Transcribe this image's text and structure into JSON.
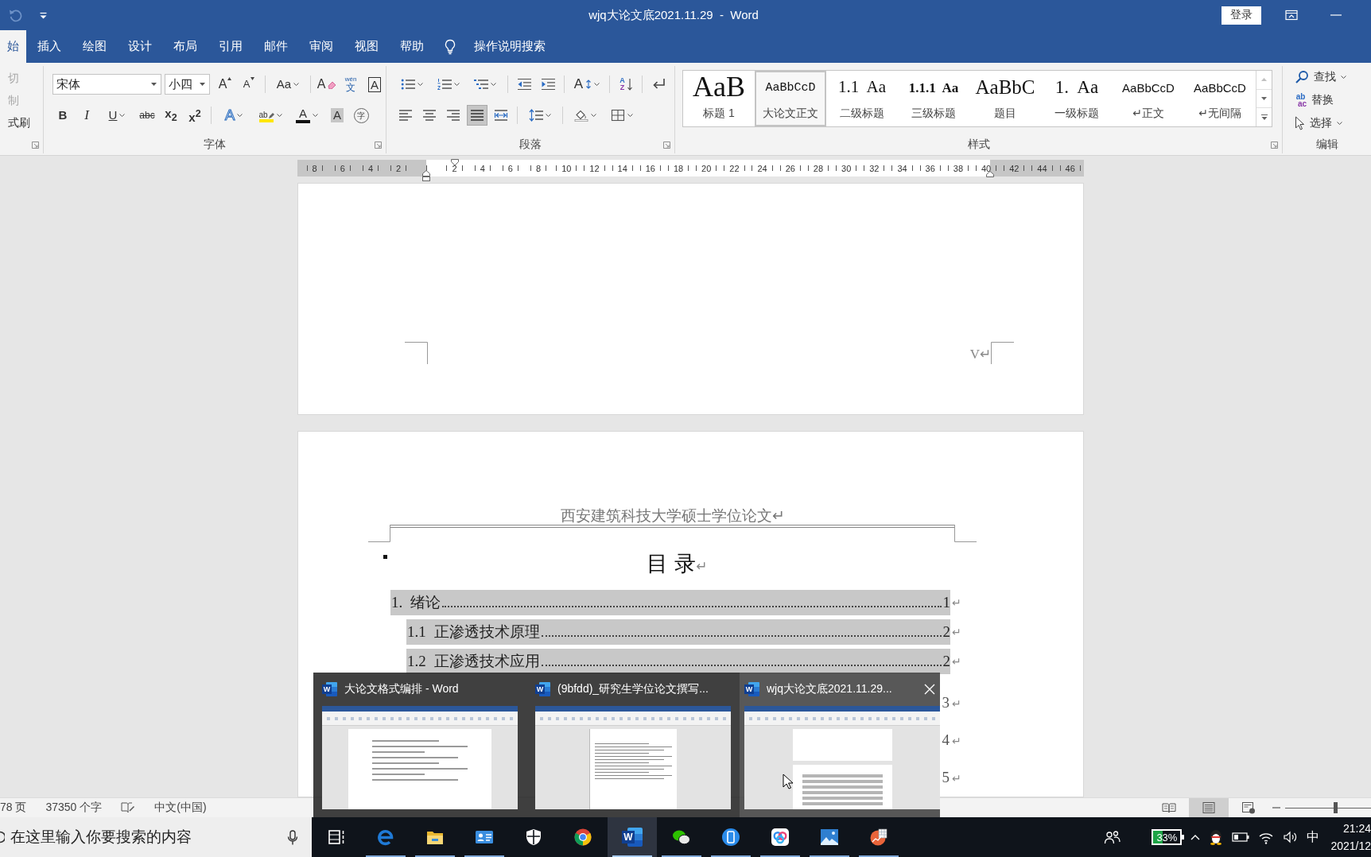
{
  "window": {
    "title": "wjq大论文底2021.11.29  -  Word",
    "sign_in": "登录"
  },
  "tabs": [
    {
      "label": "始",
      "selected": true
    },
    {
      "label": "插入",
      "selected": false
    },
    {
      "label": "绘图",
      "selected": false
    },
    {
      "label": "设计",
      "selected": false
    },
    {
      "label": "布局",
      "selected": false
    },
    {
      "label": "引用",
      "selected": false
    },
    {
      "label": "邮件",
      "selected": false
    },
    {
      "label": "审阅",
      "selected": false
    },
    {
      "label": "视图",
      "selected": false
    },
    {
      "label": "帮助",
      "selected": false
    }
  ],
  "tell_me": {
    "label": "操作说明搜索"
  },
  "clipboard_group": {
    "items": [
      {
        "label": "切",
        "disabled": true
      },
      {
        "label": "制",
        "disabled": true
      },
      {
        "label": "式刷",
        "disabled": false
      }
    ]
  },
  "font_group": {
    "label": "字体",
    "font_name": "宋体",
    "font_size": "小四",
    "row1": [
      [
        {
          "kind": "grow-font",
          "glyph": "A",
          "dropdown": false
        },
        {
          "kind": "shrink-font",
          "glyph": "A",
          "dropdown": false
        }
      ],
      [
        {
          "kind": "change-case",
          "glyph": "Aa",
          "dropdown": true
        }
      ],
      [
        {
          "kind": "clear-format",
          "glyph": "A",
          "dropdown": false
        },
        {
          "kind": "phonetic-guide",
          "glyph": "wén",
          "glyph2": "文",
          "dropdown": false
        },
        {
          "kind": "character-border",
          "glyph": "A",
          "dropdown": false
        }
      ]
    ],
    "row2": [
      [
        {
          "kind": "bold",
          "glyph": "B",
          "dropdown": false
        },
        {
          "kind": "italic",
          "glyph": "I",
          "dropdown": false
        },
        {
          "kind": "underline",
          "glyph": "U",
          "dropdown": true
        },
        {
          "kind": "strikethrough",
          "glyph": "abc",
          "dropdown": false
        },
        {
          "kind": "subscript",
          "glyph": "x$_{2}$",
          "dropdown": false
        },
        {
          "kind": "superscript",
          "glyph": "x$^{2}$",
          "dropdown": false
        }
      ],
      [
        {
          "kind": "text-effects",
          "glyph": "A",
          "dropdown": true
        },
        {
          "kind": "highlight",
          "glyph": "ab",
          "dropdown": true
        },
        {
          "kind": "font-color",
          "glyph": "A",
          "dropdown": true
        },
        {
          "kind": "character-shading",
          "glyph": "A",
          "dropdown": false
        },
        {
          "kind": "enclose-character",
          "glyph": "字",
          "dropdown": false
        }
      ]
    ]
  },
  "paragraph_group": {
    "label": "段落",
    "row1": [
      [
        {
          "kind": "bullets",
          "dropdown": true
        },
        {
          "kind": "numbering",
          "dropdown": true
        },
        {
          "kind": "multilevel-list",
          "dropdown": true
        }
      ],
      [
        {
          "kind": "decrease-indent",
          "dropdown": false
        },
        {
          "kind": "increase-indent",
          "dropdown": false
        }
      ],
      [
        {
          "kind": "asian-layout",
          "glyph": "A",
          "dropdown": true
        }
      ],
      [
        {
          "kind": "sort",
          "glyph": "A",
          "glyph2": "Z",
          "dropdown": false
        }
      ],
      [
        {
          "kind": "show-marks",
          "dropdown": false
        }
      ]
    ],
    "row2": [
      [
        {
          "kind": "align-left",
          "dropdown": false,
          "selected": false
        },
        {
          "kind": "align-center",
          "dropdown": false,
          "selected": false
        },
        {
          "kind": "align-right",
          "dropdown": false,
          "selected": false
        },
        {
          "kind": "justify",
          "dropdown": false,
          "selected": true
        },
        {
          "kind": "distribute",
          "dropdown": false,
          "selected": false
        }
      ],
      [
        {
          "kind": "line-spacing",
          "dropdown": true
        }
      ],
      [
        {
          "kind": "shading",
          "dropdown": true
        },
        {
          "kind": "borders",
          "dropdown": true
        }
      ]
    ]
  },
  "styles_group": {
    "label": "样式",
    "items": [
      {
        "kind": "title1",
        "preview": "AaB",
        "label": "标题 1",
        "selected": false
      },
      {
        "kind": "body",
        "preview": "AaBbCcD",
        "label": "大论文正文",
        "selected": true
      },
      {
        "kind": "h2",
        "preview": "1.1  Aa",
        "label": "二级标题",
        "selected": false
      },
      {
        "kind": "h3",
        "preview": "1.1.1  Aa",
        "label": "三级标题",
        "selected": false
      },
      {
        "kind": "topic",
        "preview": "AaBbC",
        "label": "题目",
        "selected": false
      },
      {
        "kind": "h1",
        "preview": "1.  Aa",
        "label": "一级标题",
        "selected": false
      },
      {
        "kind": "normal",
        "preview": "AaBbCcD",
        "label": "↵正文",
        "selected": false
      },
      {
        "kind": "nospace",
        "preview": "AaBbCcD",
        "label": "↵无间隔",
        "selected": false
      }
    ]
  },
  "editing_group": {
    "label": "编辑",
    "items": [
      {
        "kind": "find",
        "label": "查找",
        "dropdown": true
      },
      {
        "kind": "replace",
        "label": "替换",
        "glyph": "ab",
        "glyph2": "ac",
        "dropdown": false
      },
      {
        "kind": "select",
        "label": "选择",
        "dropdown": true
      }
    ]
  },
  "ruler": {
    "left_marks": [
      "8",
      "6",
      "4",
      "2"
    ],
    "marks": [
      "2",
      "4",
      "6",
      "8",
      "10",
      "12",
      "14",
      "16",
      "18",
      "20",
      "22",
      "24",
      "26",
      "28",
      "30",
      "32",
      "34",
      "36",
      "38",
      "40",
      "42",
      "44",
      "46"
    ]
  },
  "document": {
    "page_number": "V↵",
    "header": "西安建筑科技大学硕士学位论文↵",
    "toc_title": "目 录",
    "toc_title_mark": "↵",
    "toc": [
      {
        "number": "1.",
        "title": "绪论",
        "page": "1",
        "mark": "↵",
        "children": [
          {
            "number": "1.1",
            "title": "正渗透技术原理",
            "page": "2",
            "mark": "↵"
          },
          {
            "number": "1.2",
            "title": "正渗透技术应用",
            "page": "2",
            "mark": "↵",
            "children": [
              {
                "page": "3",
                "mark": "↵"
              },
              {
                "page": "4",
                "mark": "↵"
              },
              {
                "page": "5",
                "mark": "↵"
              }
            ]
          }
        ]
      }
    ]
  },
  "window_previews": [
    {
      "kind": "wide-page",
      "letter": "W",
      "title": "大论文格式编排 - Word",
      "hovered": false
    },
    {
      "kind": "narrow-page",
      "letter": "W",
      "title": "(9bfdd)_研究生学位论文撰写...",
      "hovered": false
    },
    {
      "kind": "two-pages",
      "letter": "W",
      "title": "wjq大论文底2021.11.29...",
      "hovered": true
    }
  ],
  "status_bar": {
    "page": "78 页",
    "words": "37350 个字",
    "language": "中文(中国)",
    "views": [
      {
        "kind": "read",
        "selected": false
      },
      {
        "kind": "print",
        "selected": true
      },
      {
        "kind": "web",
        "selected": false
      }
    ],
    "zoom": {
      "level": 0.58
    }
  },
  "taskbar": {
    "search": {
      "placeholder": "在这里输入你要搜索的内容"
    },
    "apps": [
      {
        "kind": "task-view",
        "running": false,
        "selected": false
      },
      {
        "kind": "e-browser",
        "running": true,
        "selected": false
      },
      {
        "kind": "folder",
        "running": true,
        "selected": false
      },
      {
        "kind": "contact-card",
        "running": true,
        "selected": false
      },
      {
        "kind": "shield",
        "running": false,
        "selected": false
      },
      {
        "kind": "color-wheel",
        "running": false,
        "selected": false
      },
      {
        "kind": "w-document",
        "letter": "W",
        "running": true,
        "selected": true
      },
      {
        "kind": "chat",
        "running": true,
        "selected": false
      },
      {
        "kind": "phone",
        "running": true,
        "selected": false
      },
      {
        "kind": "cloud",
        "running": true,
        "selected": false
      },
      {
        "kind": "photo",
        "running": true,
        "selected": false
      },
      {
        "kind": "chart",
        "running": true,
        "selected": false
      }
    ],
    "tray": {
      "battery_widget": {
        "level": 0.33,
        "reading": "33%"
      },
      "ime": "中",
      "time": "21:24",
      "date": "2021/12"
    }
  }
}
